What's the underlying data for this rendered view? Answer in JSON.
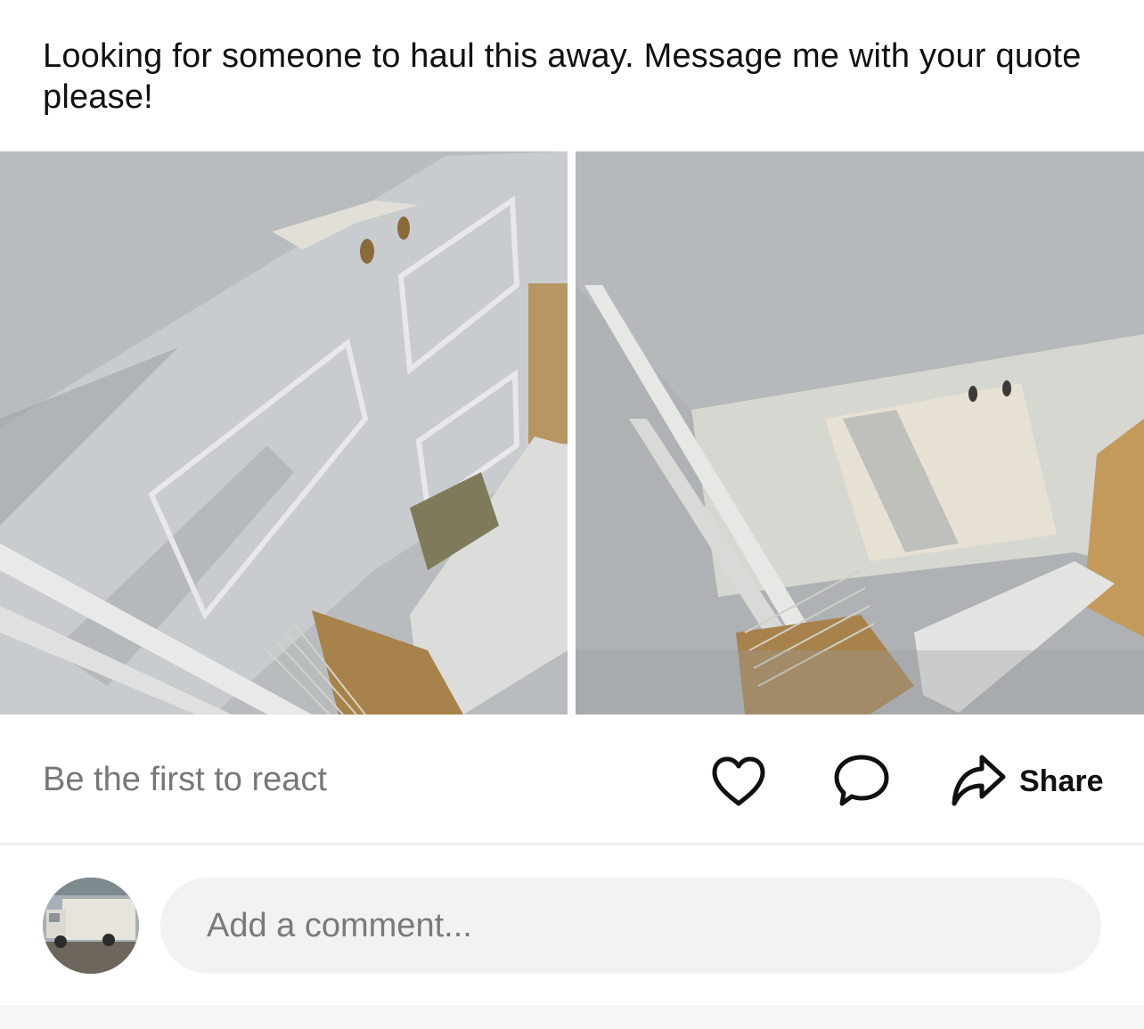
{
  "post": {
    "text": "Looking for someone to haul this away. Message me with your quote please!"
  },
  "photos": [
    {
      "icon": "photo-door-left"
    },
    {
      "icon": "photo-door-right"
    }
  ],
  "reactions": {
    "status_text": "Be the first to react",
    "like_icon": "heart-icon",
    "comment_icon": "comment-bubble-icon",
    "share_icon": "share-arrow-icon",
    "share_label": "Share"
  },
  "comment": {
    "placeholder": "Add a comment...",
    "avatar_icon": "avatar-truck"
  },
  "colors": {
    "text": "#111111",
    "muted": "#777777",
    "input_bg": "#f2f2f2",
    "divider": "#ececec"
  }
}
